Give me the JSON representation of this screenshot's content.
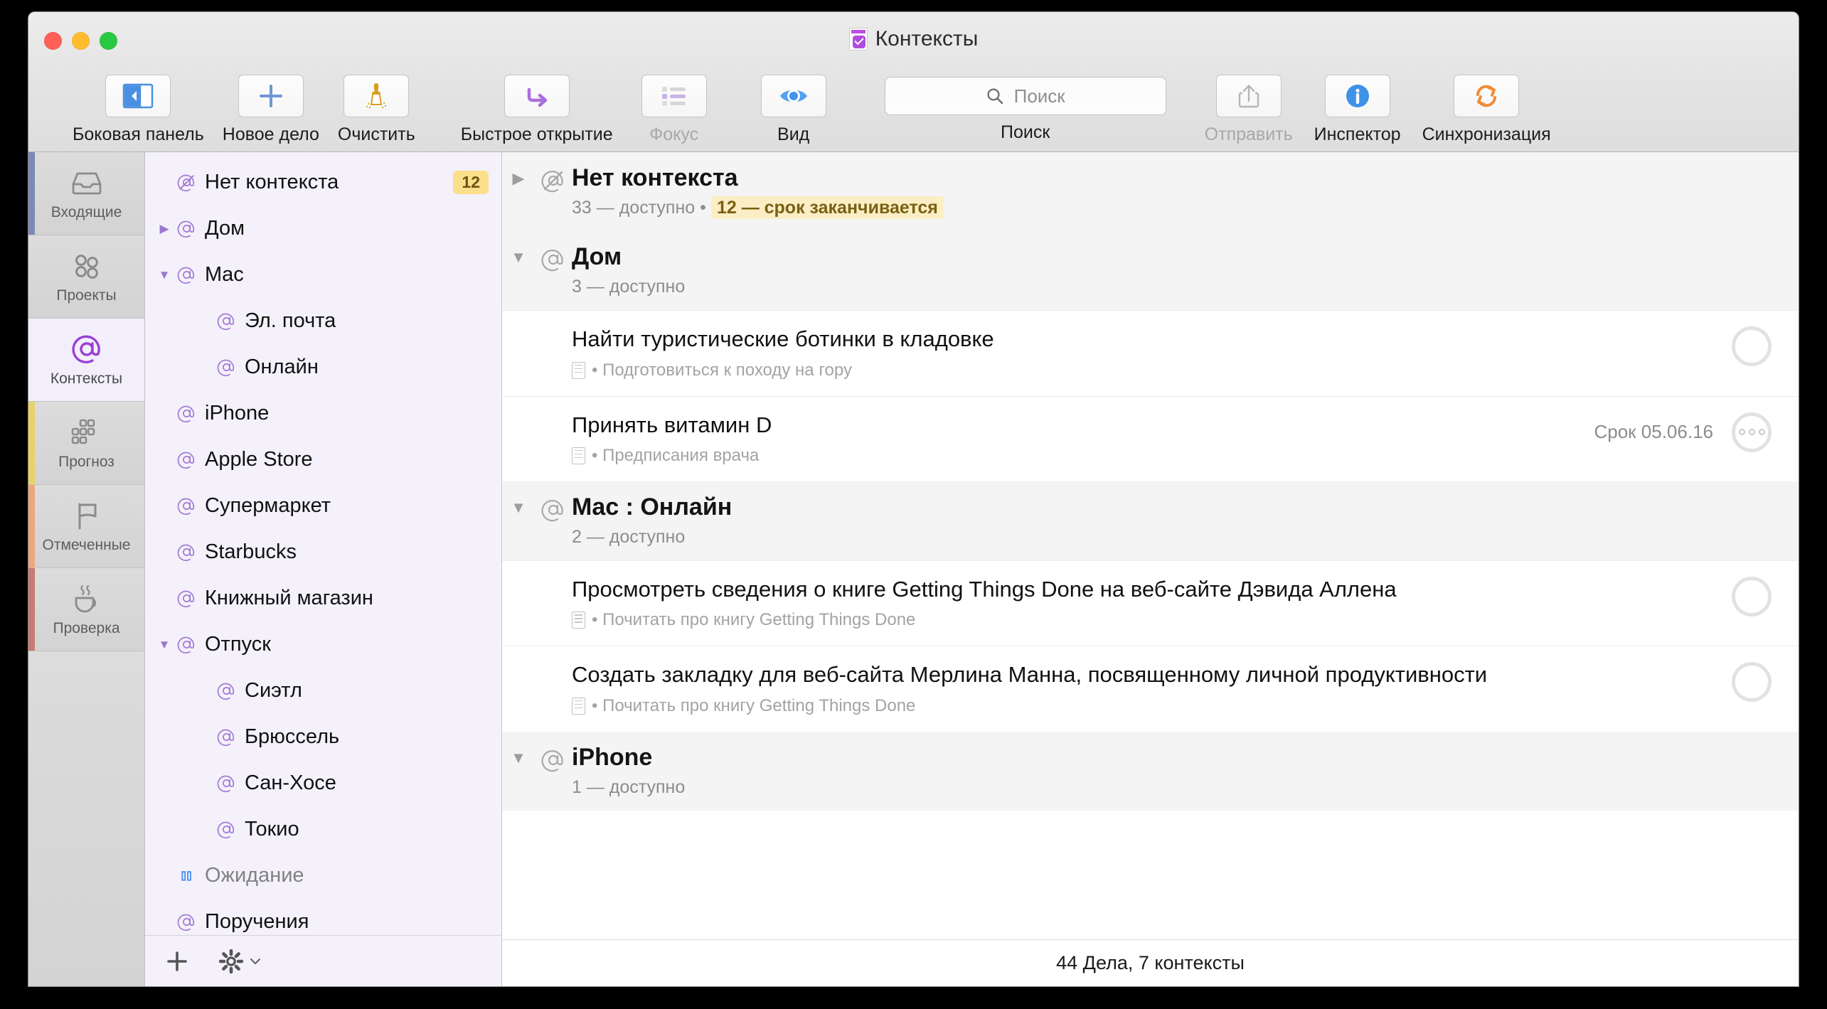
{
  "window": {
    "title": "Контексты",
    "doc_icon": "purple-checkbox-document-icon"
  },
  "toolbar": {
    "items": [
      {
        "label": "Боковая панель",
        "icon": "sidebar-toggle-icon",
        "disabled": false
      },
      {
        "label": "Новое дело",
        "icon": "plus-icon",
        "disabled": false
      },
      {
        "label": "Очистить",
        "icon": "broom-icon",
        "disabled": false
      },
      {
        "label": "Быстрое открытие",
        "icon": "arrow-right-icon",
        "disabled": false
      },
      {
        "label": "Фокус",
        "icon": "list-focus-icon",
        "disabled": true
      },
      {
        "label": "Вид",
        "icon": "eye-icon",
        "disabled": false
      }
    ],
    "search": {
      "label": "Поиск",
      "placeholder": "Поиск",
      "icon": "search-icon",
      "value": ""
    },
    "right_items": [
      {
        "label": "Отправить",
        "icon": "share-icon",
        "disabled": true
      },
      {
        "label": "Инспектор",
        "icon": "info-icon",
        "disabled": false
      },
      {
        "label": "Синхронизация",
        "icon": "sync-icon",
        "disabled": false
      }
    ]
  },
  "perspectives": [
    {
      "label": "Входящие",
      "icon": "inbox-icon",
      "accent": "#7b8bb5",
      "selected": false
    },
    {
      "label": "Проекты",
      "icon": "projects-icon",
      "accent": "",
      "selected": false
    },
    {
      "label": "Контексты",
      "icon": "at-icon",
      "accent": "",
      "selected": true
    },
    {
      "label": "Прогноз",
      "icon": "forecast-icon",
      "accent": "#e8d26a",
      "selected": false
    },
    {
      "label": "Отмеченные",
      "icon": "flag-icon",
      "accent": "#eda77e",
      "selected": false
    },
    {
      "label": "Проверка",
      "icon": "cup-icon",
      "accent": "#c97a74",
      "selected": false
    }
  ],
  "context_sidebar": {
    "items": [
      {
        "label": "Нет контекста",
        "icon": "no-context-icon",
        "twisty": "",
        "indent": 0,
        "badge": "12",
        "muted": false
      },
      {
        "label": "Дом",
        "icon": "at-icon",
        "twisty": "▶",
        "indent": 0,
        "badge": "",
        "muted": false
      },
      {
        "label": "Mac",
        "icon": "at-icon",
        "twisty": "▼",
        "indent": 0,
        "badge": "",
        "muted": false
      },
      {
        "label": "Эл. почта",
        "icon": "at-icon",
        "twisty": "",
        "indent": 1,
        "badge": "",
        "muted": false
      },
      {
        "label": "Онлайн",
        "icon": "at-icon",
        "twisty": "",
        "indent": 1,
        "badge": "",
        "muted": false
      },
      {
        "label": "iPhone",
        "icon": "at-icon",
        "twisty": "",
        "indent": 0,
        "badge": "",
        "muted": false
      },
      {
        "label": "Apple Store",
        "icon": "at-icon",
        "twisty": "",
        "indent": 0,
        "badge": "",
        "muted": false
      },
      {
        "label": "Супермаркет",
        "icon": "at-icon",
        "twisty": "",
        "indent": 0,
        "badge": "",
        "muted": false
      },
      {
        "label": "Starbucks",
        "icon": "at-icon",
        "twisty": "",
        "indent": 0,
        "badge": "",
        "muted": false
      },
      {
        "label": "Книжный магазин",
        "icon": "at-icon",
        "twisty": "",
        "indent": 0,
        "badge": "",
        "muted": false
      },
      {
        "label": "Отпуск",
        "icon": "at-icon",
        "twisty": "▼",
        "indent": 0,
        "badge": "",
        "muted": false
      },
      {
        "label": "Сиэтл",
        "icon": "at-icon",
        "twisty": "",
        "indent": 1,
        "badge": "",
        "muted": false
      },
      {
        "label": "Брюссель",
        "icon": "at-icon",
        "twisty": "",
        "indent": 1,
        "badge": "",
        "muted": false
      },
      {
        "label": "Сан-Хосе",
        "icon": "at-icon",
        "twisty": "",
        "indent": 1,
        "badge": "",
        "muted": false
      },
      {
        "label": "Токио",
        "icon": "at-icon",
        "twisty": "",
        "indent": 1,
        "badge": "",
        "muted": false
      },
      {
        "label": "Ожидание",
        "icon": "on-hold-icon",
        "twisty": "",
        "indent": 0,
        "badge": "",
        "muted": true
      },
      {
        "label": "Поручения",
        "icon": "at-icon",
        "twisty": "",
        "indent": 0,
        "badge": "",
        "muted": false
      }
    ],
    "footer": {
      "add_icon": "plus-icon",
      "settings_icon": "gear-icon",
      "settings_chevron": "chevron-down-icon"
    }
  },
  "outline": [
    {
      "kind": "group",
      "twisty": "▶",
      "icon": "no-context-icon",
      "title": "Нет контекста",
      "available": "33 — доступно",
      "separator": "•",
      "warning": "12 — срок заканчивается"
    },
    {
      "kind": "group",
      "twisty": "▼",
      "icon": "at-icon",
      "title": "Дом",
      "available": "3 — доступно",
      "separator": "",
      "warning": ""
    },
    {
      "kind": "task",
      "title": "Найти туристические ботинки в кладовке",
      "note_icon": "note-icon",
      "project": "• Подготовиться к походу на гору",
      "due": "",
      "status_icon": "empty-circle-icon"
    },
    {
      "kind": "task",
      "title": "Принять витамин D",
      "note_icon": "note-icon",
      "project": "• Предписания врача",
      "due": "Срок 05.06.16",
      "status_icon": "repeating-circle-icon"
    },
    {
      "kind": "group",
      "twisty": "▼",
      "icon": "at-icon",
      "title": "Mac : Онлайн",
      "available": "2 — доступно",
      "separator": "",
      "warning": ""
    },
    {
      "kind": "task",
      "title": "Просмотреть сведения о книге Getting Things Done на веб-сайте Дэвида Аллена",
      "note_icon": "note-icon",
      "project": "• Почитать про книгу Getting Things Done",
      "due": "",
      "status_icon": "empty-circle-icon"
    },
    {
      "kind": "task",
      "title": "Создать закладку для веб-сайта Мерлина Манна, посвященному личной продуктивности",
      "note_icon": "note-icon",
      "project": "• Почитать про книгу Getting Things Done",
      "due": "",
      "status_icon": "empty-circle-icon"
    },
    {
      "kind": "group",
      "twisty": "▼",
      "icon": "at-icon",
      "title": "iPhone",
      "available": "1 — доступно",
      "separator": "",
      "warning": ""
    }
  ],
  "statusbar": {
    "text": "44 Дела, 7 контексты"
  },
  "colors": {
    "accent_purple": "#a366d6",
    "badge_yellow": "#fbdf8b",
    "warning_bg": "#fbeec4",
    "selected_row": "#f2eefb",
    "group_row": "#f4f4f4"
  }
}
